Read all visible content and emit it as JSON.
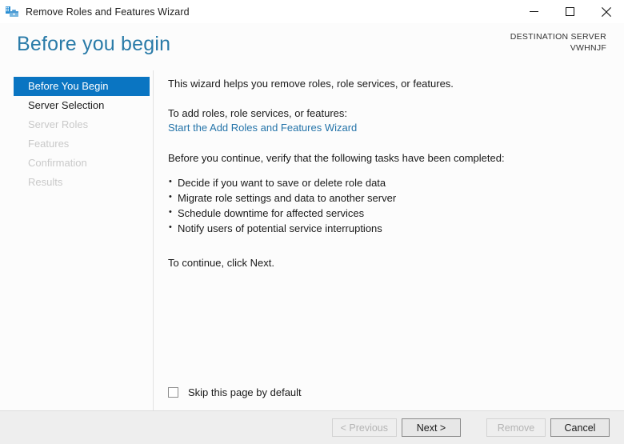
{
  "window": {
    "title": "Remove Roles and Features Wizard",
    "icon": "server-toolbox-icon",
    "controls": {
      "minimize": "minimize-icon",
      "maximize": "maximize-icon",
      "close": "close-icon"
    }
  },
  "header": {
    "page_title": "Before you begin",
    "destination_label": "DESTINATION SERVER",
    "destination_server": "VWHNJF"
  },
  "sidebar": {
    "items": [
      {
        "label": "Before You Begin",
        "state": "selected"
      },
      {
        "label": "Server Selection",
        "state": "enabled"
      },
      {
        "label": "Server Roles",
        "state": "disabled"
      },
      {
        "label": "Features",
        "state": "disabled"
      },
      {
        "label": "Confirmation",
        "state": "disabled"
      },
      {
        "label": "Results",
        "state": "disabled"
      }
    ]
  },
  "content": {
    "intro": "This wizard helps you remove roles, role services, or features.",
    "add_roles_prompt": "To add roles, role services, or features:",
    "add_roles_link": "Start the Add Roles and Features Wizard",
    "verify_prompt": "Before you continue, verify that the following tasks have been completed:",
    "tasks": [
      "Decide if you want to save or delete role data",
      "Migrate role settings and data to another server",
      "Schedule downtime for affected services",
      "Notify users of potential service interruptions"
    ],
    "continue_text": "To continue, click Next.",
    "skip_checkbox_label": "Skip this page by default",
    "skip_checkbox_checked": false
  },
  "footer": {
    "previous_label": "< Previous",
    "next_label": "Next >",
    "remove_label": "Remove",
    "cancel_label": "Cancel",
    "previous_enabled": false,
    "next_enabled": true,
    "remove_enabled": false,
    "cancel_enabled": true
  },
  "colors": {
    "accent_blue": "#0a75c2",
    "title_blue": "#2a7ba8",
    "link_blue": "#2574a9",
    "disabled_gray": "#c9c9c9",
    "footer_bg": "#eeeeee"
  }
}
